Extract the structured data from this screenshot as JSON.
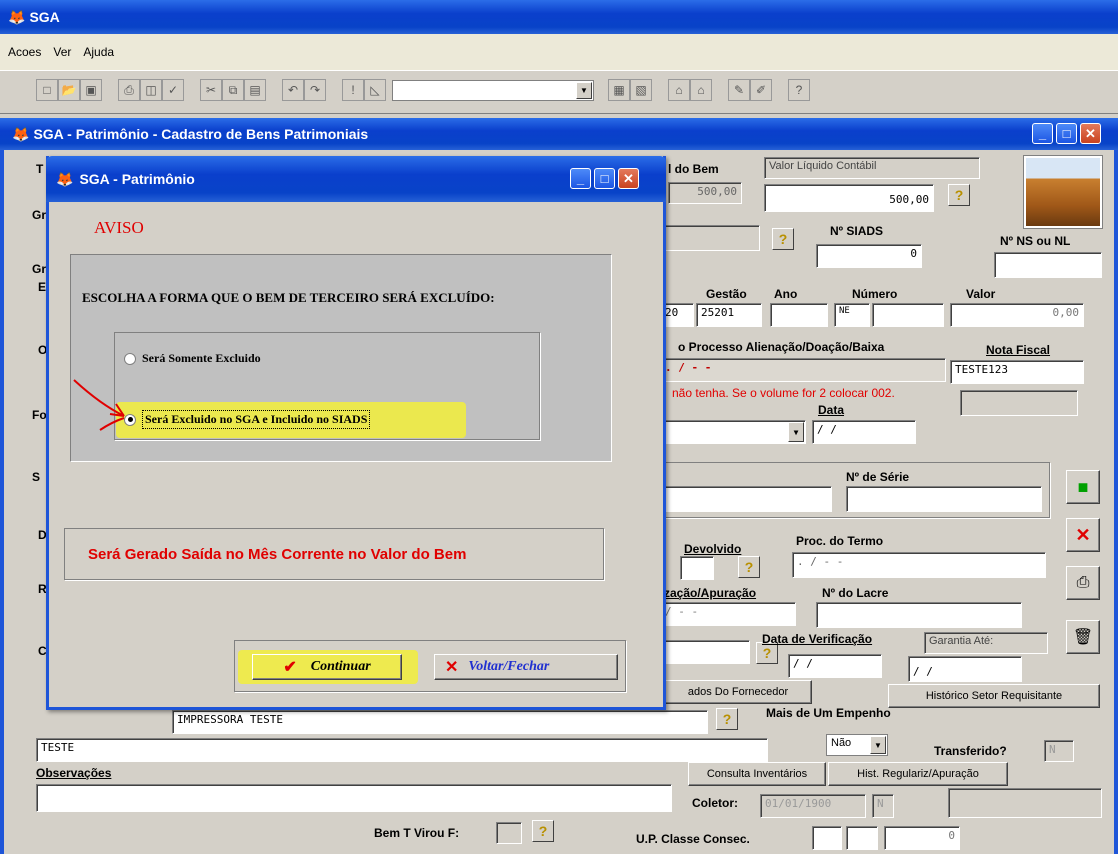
{
  "app": {
    "title": "SGA",
    "menu": [
      "Acoes",
      "Ver",
      "Ajuda"
    ]
  },
  "child": {
    "title": "SGA - Patrimônio - Cadastro de Bens Patrimoniais"
  },
  "dialog": {
    "title": "SGA - Patrimônio",
    "aviso": "AVISO",
    "question": "ESCOLHA A FORMA QUE O BEM DE TERCEIRO SERÁ EXCLUÍDO:",
    "option1": "Será Somente Excluido",
    "option2": "Será Excluido no SGA e Incluido no SIADS",
    "selected": "option2",
    "message": "Será Gerado Saída no Mês Corrente no Valor do Bem",
    "continue": "Continuar",
    "close": "Voltar/Fechar"
  },
  "form": {
    "labels": {
      "do_bem": "l do Bem",
      "siads": "Nº SIADS",
      "ns_nl": "Nº NS ou NL",
      "gestao": "Gestão",
      "ano": "Ano",
      "numero": "Número",
      "valor": "Valor",
      "processo": "o Processo Alienação/Doação/Baixa",
      "nota_fiscal": "Nota Fiscal",
      "data": "Data",
      "serie": "Nº de Série",
      "devolvido": "Devolvido",
      "proc_termo": "Proc. do Termo",
      "apuracao": "zação/Apuração",
      "lacre": "Nº do Lacre",
      "data_verif": "Data de Verificação",
      "mais_empenho": "Mais de Um Empenho",
      "transferido": "Transferido?",
      "observacoes": "Observações",
      "coletor": "Coletor:",
      "bem_virou": "Bem T Virou F:",
      "up_classe": "U.P. Classe  Consec."
    },
    "values": {
      "valor_bem": "500,00",
      "valor_liquido_label": "Valor Líquido Contábil",
      "valor_liquido": "500,00",
      "siads": "0",
      "gestao_prefix": "20",
      "gestao": "25201",
      "ne": "NE",
      "valor": "0,00",
      "processo": ".      /      -    -",
      "hint": "não tenha. Se o volume for 2 colocar 002.",
      "nota_fiscal": "TESTE123",
      "data": " /  /",
      "proc_termo": ".        /      -    -",
      "apuracao": "/      -    -",
      "data_verif": " /  /",
      "garantia_label": "Garantia Até:",
      "garantia": " /  /",
      "impressora": "IMPRESSORA TESTE",
      "teste": "TESTE",
      "nao": "Não",
      "transferido": "N",
      "coletor_date": "01/01/1900",
      "coletor_flag": "N",
      "consec": "0"
    },
    "buttons": {
      "fornecedor": "ados Do Fornecedor",
      "historico": "Histórico Setor Requisitante",
      "inventarios": "Consulta Inventários",
      "hist_regulariz": "Hist. Regulariz/Apuração"
    },
    "left_letters": [
      "T",
      "Gr",
      "Gr",
      "E",
      "O",
      "Fo",
      "S",
      "D",
      "R",
      "C"
    ]
  }
}
